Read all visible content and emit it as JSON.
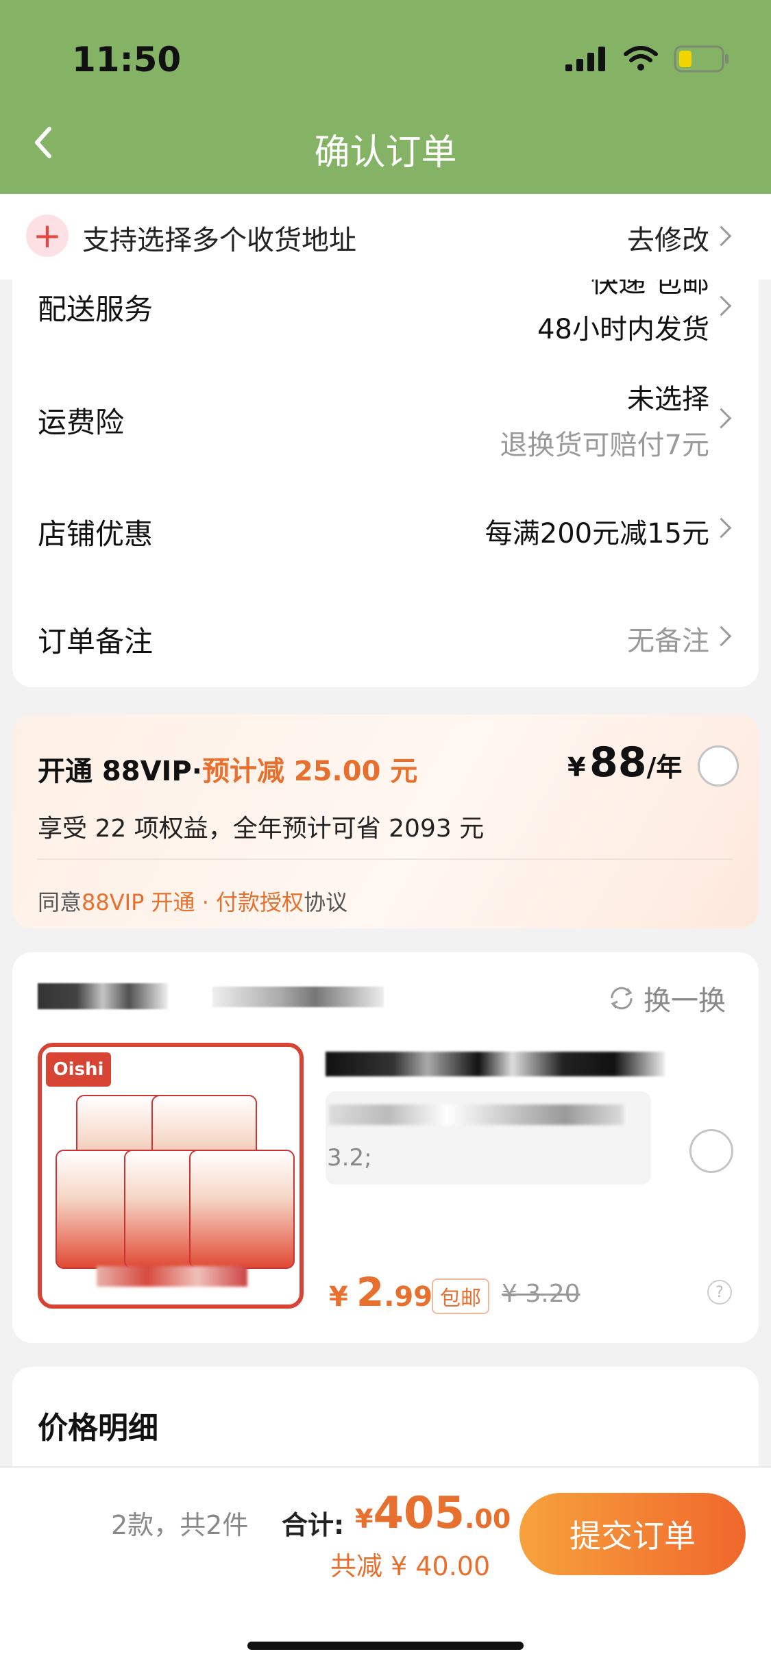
{
  "status_bar": {
    "time": "11:50"
  },
  "header": {
    "title": "确认订单"
  },
  "address_banner": {
    "text": "支持选择多个收货地址",
    "action": "去修改"
  },
  "order_rows": [
    {
      "label": "配送服务",
      "value_top": "快递 包邮",
      "value": "48小时内发货"
    },
    {
      "label": "运费险",
      "value": "未选择",
      "sub": "退换货可赔付7元"
    },
    {
      "label": "店铺优惠",
      "value": "每满200元减15元"
    },
    {
      "label": "订单备注",
      "value": "无备注"
    }
  ],
  "vip": {
    "title": "开通 88VIP·",
    "discount": "预计减 25.00 元",
    "currency": "¥",
    "price": "88",
    "unit": "/年",
    "benefit": "享受 22 项权益，全年预计可省 2093 元",
    "agree_prefix": "同意",
    "agree_link": "88VIP 开通 · 付款授权",
    "agree_suffix": "协议"
  },
  "product": {
    "swap": "换一换",
    "spec": "3.2;",
    "currency": "¥",
    "price_int": "2",
    "price_dec": ".99",
    "free_ship": "包邮",
    "orig_price": "¥ 3.20",
    "help": "?"
  },
  "price_detail": {
    "title": "价格明细"
  },
  "footer": {
    "count": "2款，共2件",
    "total_label": "合计:",
    "currency": "¥",
    "total_int": "405",
    "total_dec": ".00",
    "saving": "共减 ¥ 40.00",
    "submit": "提交订单"
  }
}
